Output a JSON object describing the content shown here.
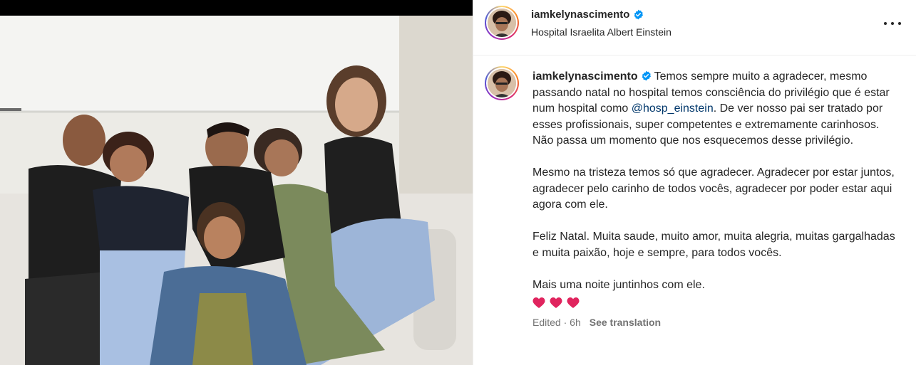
{
  "post": {
    "username": "iamkelynascimento",
    "location": "Hospital Israelita Albert Einstein",
    "verified": true,
    "caption": {
      "line1_pre": "Temos sempre muito a agradecer, mesmo passando natal no hospital temos consciência do privilégio que é estar num hospital como ",
      "mention": "@hosp_einstein",
      "line1_post": ". De ver nosso pai ser tratado por esses profissionais, super competentes e extremamente carinhosos.",
      "line2": "Não passa um momento que nos esquecemos desse privilégio.",
      "para2": "Mesmo na tristeza temos só que agradecer. Agradecer por estar juntos, agradecer pelo carinho de todos vocês, agradecer por poder estar aqui agora com ele.",
      "para3": "Feliz Natal. Muita saude, muito amor, muita alegria, muitas gargalhadas e muita paixão, hoje e sempre, para todos vocês.",
      "para4": "Mais uma noite juntinhos com ele."
    },
    "hearts": [
      "red-heart-emoji",
      "red-heart-emoji",
      "red-heart-emoji"
    ],
    "edited_label": "Edited",
    "time": "6h",
    "see_translation": "See translation"
  },
  "icons": {
    "more": "more-options-icon",
    "verified": "verified-badge-icon"
  },
  "colors": {
    "verified_blue": "#0095f6",
    "mention": "#00376b",
    "heart": "#e0245e",
    "secondary_text": "#737373"
  }
}
